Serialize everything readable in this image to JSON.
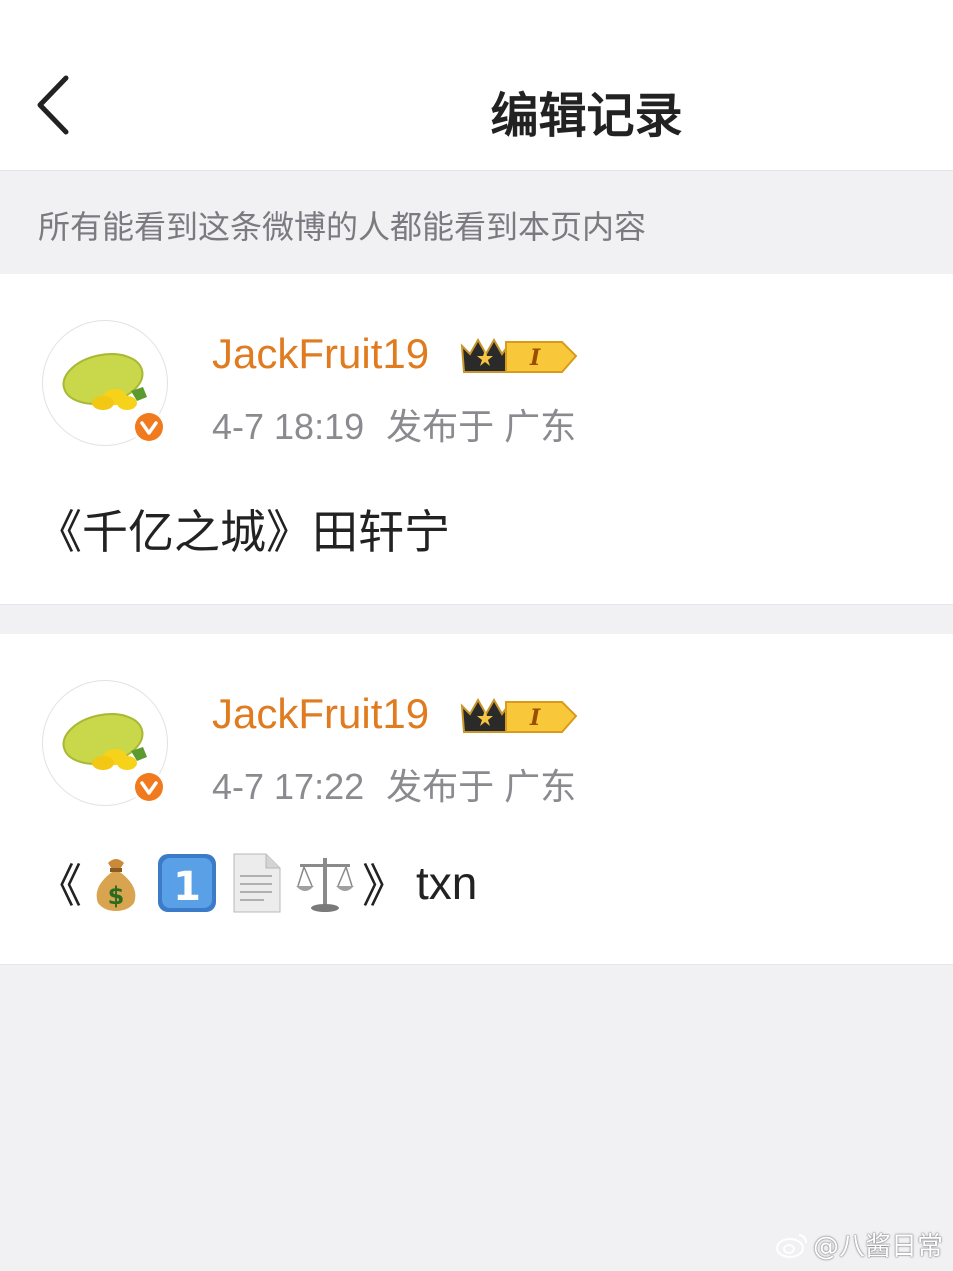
{
  "header": {
    "title": "编辑记录",
    "back_icon": "chevron-left-icon"
  },
  "notice": "所有能看到这条微博的人都能看到本页内容",
  "records": [
    {
      "username": "JackFruit19",
      "time": "4-7 18:19",
      "location": "发布于 广东",
      "content": "《千亿之城》田轩宁",
      "badge_label": "I"
    },
    {
      "username": "JackFruit19",
      "time": "4-7 17:22",
      "location": "发布于 广东",
      "content_open": "《",
      "content_emojis": [
        "money-bag-emoji",
        "keycap-1-emoji",
        "page-emoji",
        "scales-emoji"
      ],
      "content_close": "》",
      "content_text": "txn",
      "badge_label": "I"
    }
  ],
  "watermark": "@八酱日常",
  "colors": {
    "username": "#e07b1f",
    "verified": "#f07a1d",
    "background": "#f1f1f4"
  }
}
